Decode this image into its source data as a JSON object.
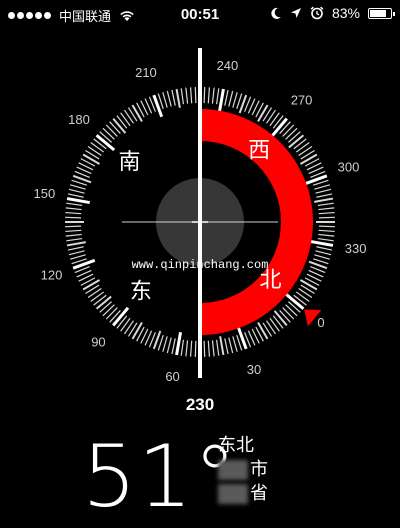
{
  "status_bar": {
    "carrier": "中国联通",
    "time": "00:51",
    "battery_percent": "83%",
    "battery_level": 0.83,
    "signal_bars": 5
  },
  "compass": {
    "heading_label": "230",
    "degree_labels": [
      "0",
      "30",
      "60",
      "90",
      "120",
      "150",
      "180",
      "210",
      "240",
      "270",
      "300",
      "330"
    ],
    "cardinals": {
      "north": "北",
      "east": "东",
      "south": "南",
      "west": "西"
    },
    "watermark": "www.qinpinchang.com",
    "colors": {
      "accent": "#ff0000",
      "background": "#000000",
      "ring": "#ffffff",
      "center": "#4a4a4a"
    }
  },
  "heading_info": {
    "degrees": "51°",
    "direction": "东北",
    "city_suffix": "市",
    "province_suffix": "省"
  }
}
